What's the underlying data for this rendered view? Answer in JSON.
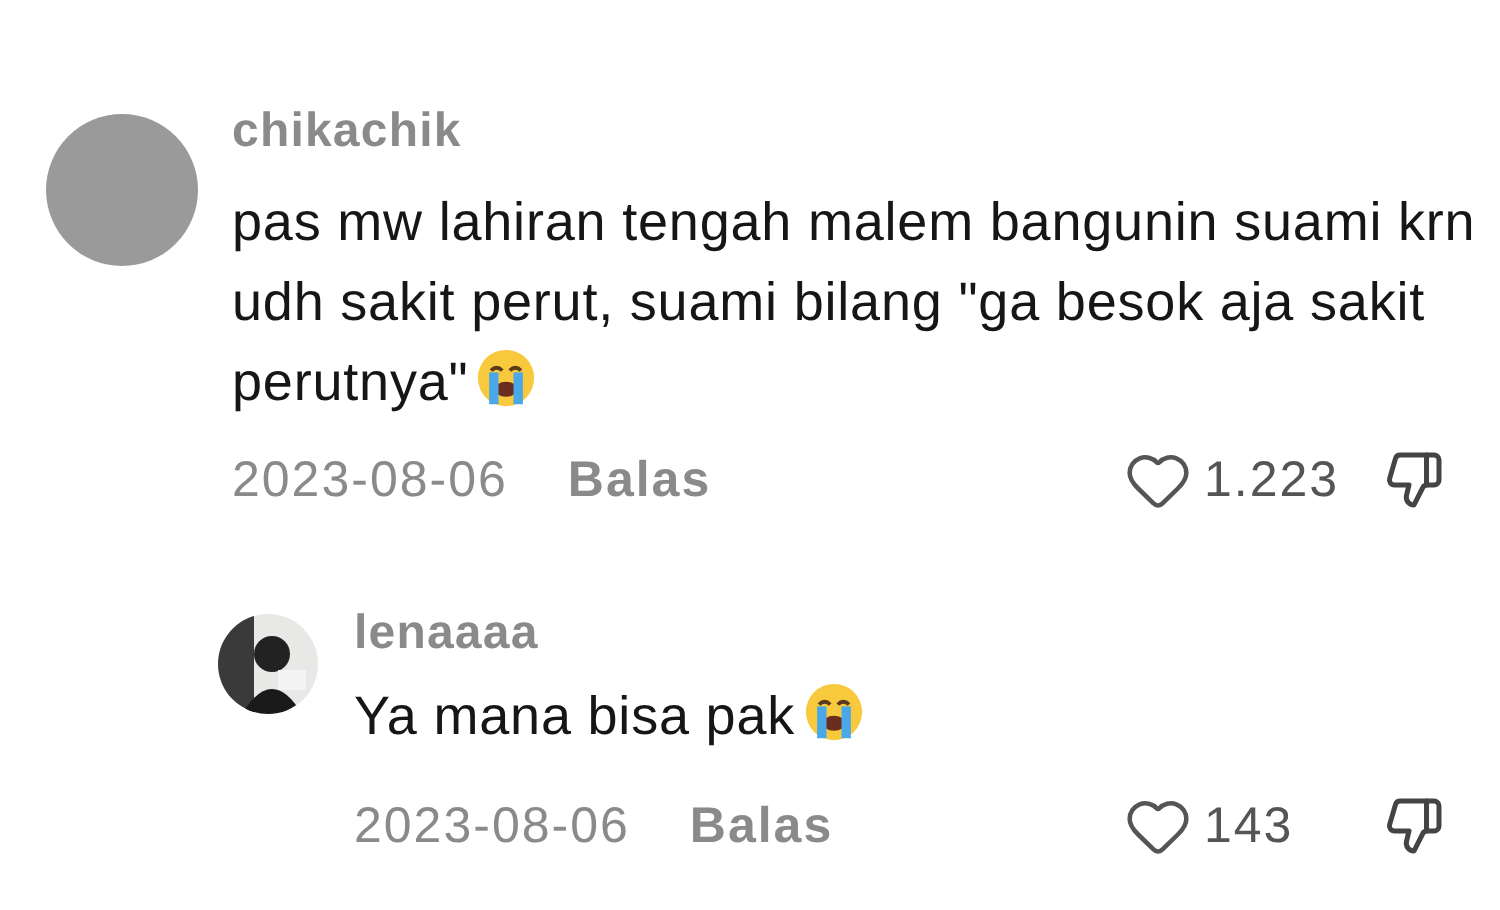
{
  "comments": [
    {
      "username": "chikachik",
      "avatar": {
        "kind": "plain"
      },
      "text": "pas mw lahiran tengah malem bangunin suami krn udh sakit perut, suami bilang \"ga besok aja sakit perutnya\"",
      "date": "2023-08-06",
      "reply_label": "Balas",
      "likes": "1.223",
      "replies": [
        {
          "username": "lenaaaa",
          "text": "Ya mana bisa pak",
          "date": "2023-08-06",
          "reply_label": "Balas",
          "likes": "143"
        }
      ]
    }
  ]
}
